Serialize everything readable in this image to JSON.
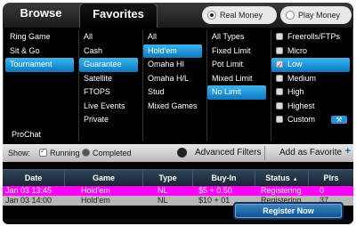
{
  "tabs": {
    "browse": "Browse",
    "favorites": "Favorites"
  },
  "money": {
    "real": "Real Money",
    "play": "Play Money"
  },
  "filters": {
    "game_category": [
      "Ring Game",
      "Sit & Go",
      "Tournament"
    ],
    "tournament_type": [
      "All",
      "Cash",
      "Guarantee",
      "Satellite",
      "FTOPS",
      "Live Events",
      "Private"
    ],
    "game": [
      "All",
      "Hold'em",
      "Omaha HI",
      "Omaha H/L",
      "Stud",
      "Mixed Games"
    ],
    "limit": [
      "All Types",
      "Fixed Limit",
      "Pot Limit",
      "Mixed Limit",
      "No Limit"
    ],
    "stakes": [
      "Freerolls/FTPs",
      "Micro",
      "Low",
      "Medium",
      "High",
      "Highest",
      "Custom"
    ],
    "prochat": "ProChat",
    "wrench": "⚒"
  },
  "showbar": {
    "show": "Show:",
    "running": "Running",
    "completed": "Completed",
    "advanced": "Advanced Filters",
    "add_fav": "Add as Favorite",
    "plus": "+"
  },
  "table": {
    "columns": [
      "Date",
      "Game",
      "Type",
      "Buy-In",
      "Status",
      "Plrs"
    ],
    "sort_arrow": "▲",
    "rows": [
      {
        "date": "Jan 03 13:45",
        "game": "Hold'em",
        "type": "NL",
        "buyin": "$5 + 0.50",
        "status": "Registering",
        "plrs": "0"
      },
      {
        "date": "Jan 03 14:00",
        "game": "Hold'em",
        "type": "NL",
        "buyin": "$10 + 01",
        "status": "Registering",
        "plrs": "37"
      }
    ]
  },
  "register_button": "Register Now",
  "colors": {
    "selected": "#0a78c2",
    "highlight_row": "#ff00ff"
  }
}
